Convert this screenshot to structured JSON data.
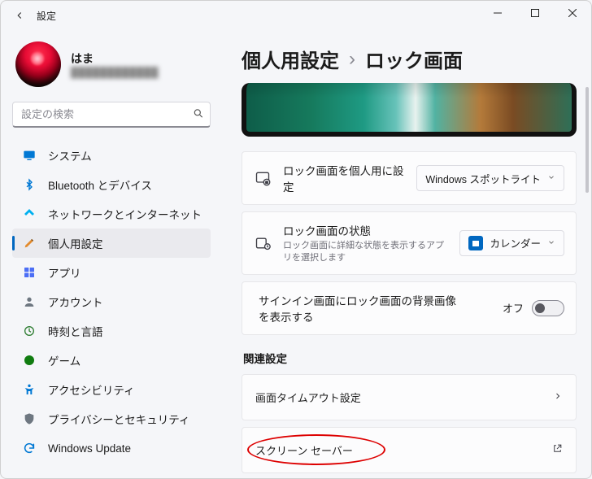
{
  "window": {
    "title": "設定"
  },
  "user": {
    "name": "はま",
    "email_obscured": "████████████"
  },
  "search": {
    "placeholder": "設定の検索"
  },
  "sidebar": {
    "items": [
      {
        "id": "system",
        "label": "システム"
      },
      {
        "id": "bluetooth",
        "label": "Bluetooth とデバイス"
      },
      {
        "id": "network",
        "label": "ネットワークとインターネット"
      },
      {
        "id": "personalization",
        "label": "個人用設定",
        "selected": true
      },
      {
        "id": "apps",
        "label": "アプリ"
      },
      {
        "id": "accounts",
        "label": "アカウント"
      },
      {
        "id": "time",
        "label": "時刻と言語"
      },
      {
        "id": "gaming",
        "label": "ゲーム"
      },
      {
        "id": "accessibility",
        "label": "アクセシビリティ"
      },
      {
        "id": "privacy",
        "label": "プライバシーとセキュリティ"
      },
      {
        "id": "update",
        "label": "Windows Update"
      }
    ]
  },
  "breadcrumb": {
    "parent": "個人用設定",
    "separator": "›",
    "current": "ロック画面"
  },
  "rows": {
    "personalize": {
      "title": "ロック画面を個人用に設定",
      "dropdown_value": "Windows スポットライト"
    },
    "status": {
      "title": "ロック画面の状態",
      "subtitle": "ロック画面に詳細な状態を表示するアプリを選択します",
      "dropdown_value": "カレンダー"
    },
    "signin_bg": {
      "title": "サインイン画面にロック画面の背景画像を表示する",
      "toggle_label": "オフ"
    }
  },
  "related": {
    "header": "関連設定",
    "screen_timeout": "画面タイムアウト設定",
    "screensaver": "スクリーン セーバー"
  },
  "colors": {
    "accent": "#0067c0"
  }
}
